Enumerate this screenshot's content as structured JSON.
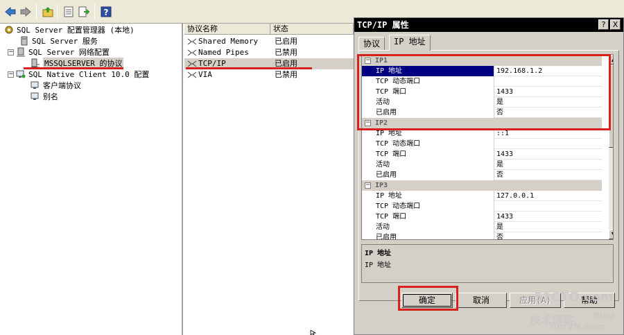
{
  "toolbar": {
    "buttons": [
      "back-arrow-icon",
      "forward-arrow-icon",
      "up-folder-icon",
      "properties-icon",
      "export-list-icon",
      "help-icon"
    ]
  },
  "tree": {
    "root": "SQL Server 配置管理器 (本地)",
    "items": [
      {
        "label": "SQL Server 服务"
      },
      {
        "label": "SQL Server 网络配置"
      },
      {
        "label": "MSSQLSERVER 的协议"
      },
      {
        "label": "SQL Native Client 10.0 配置"
      },
      {
        "label": "客户端协议"
      },
      {
        "label": "别名"
      }
    ]
  },
  "list": {
    "col_name": "协议名称",
    "col_state": "状态",
    "rows": [
      {
        "name": "Shared Memory",
        "state": "已启用"
      },
      {
        "name": "Named Pipes",
        "state": "已禁用"
      },
      {
        "name": "TCP/IP",
        "state": "已启用"
      },
      {
        "name": "VIA",
        "state": "已禁用"
      }
    ]
  },
  "dialog": {
    "title": "TCP/IP 属性",
    "help_btn": "?",
    "close_btn": "X",
    "tabs": [
      "协议",
      "IP 地址"
    ],
    "active_tab": "IP 地址",
    "sections": [
      {
        "name": "IP1",
        "props": [
          {
            "name": "IP 地址",
            "value": "192.168.1.2"
          },
          {
            "name": "TCP 动态端口",
            "value": ""
          },
          {
            "name": "TCP 端口",
            "value": "1433"
          },
          {
            "name": "活动",
            "value": "是"
          },
          {
            "name": "已启用",
            "value": "否"
          }
        ]
      },
      {
        "name": "IP2",
        "props": [
          {
            "name": "IP 地址",
            "value": "::1"
          },
          {
            "name": "TCP 动态端口",
            "value": ""
          },
          {
            "name": "TCP 端口",
            "value": "1433"
          },
          {
            "name": "活动",
            "value": "是"
          },
          {
            "name": "已启用",
            "value": "否"
          }
        ]
      },
      {
        "name": "IP3",
        "props": [
          {
            "name": "IP 地址",
            "value": "127.0.0.1"
          },
          {
            "name": "TCP 动态端口",
            "value": ""
          },
          {
            "name": "TCP 端口",
            "value": "1433"
          },
          {
            "name": "活动",
            "value": "是"
          },
          {
            "name": "已启用",
            "value": "否"
          }
        ]
      }
    ],
    "description": {
      "title": "IP 地址",
      "text": "IP 地址"
    },
    "buttons": {
      "ok": "确定",
      "cancel": "取消",
      "apply": "应用(A)",
      "help": "帮助"
    }
  },
  "watermark": {
    "line1": "51CTO.com",
    "line2": "技术博客",
    "line3": "Blog",
    "line4": "YunVN.com"
  },
  "colors": {
    "annotation_red": "#d9211c",
    "selection_blue": "#000080",
    "titlebar": "#000000",
    "dialog_face": "#d4d0c8"
  }
}
